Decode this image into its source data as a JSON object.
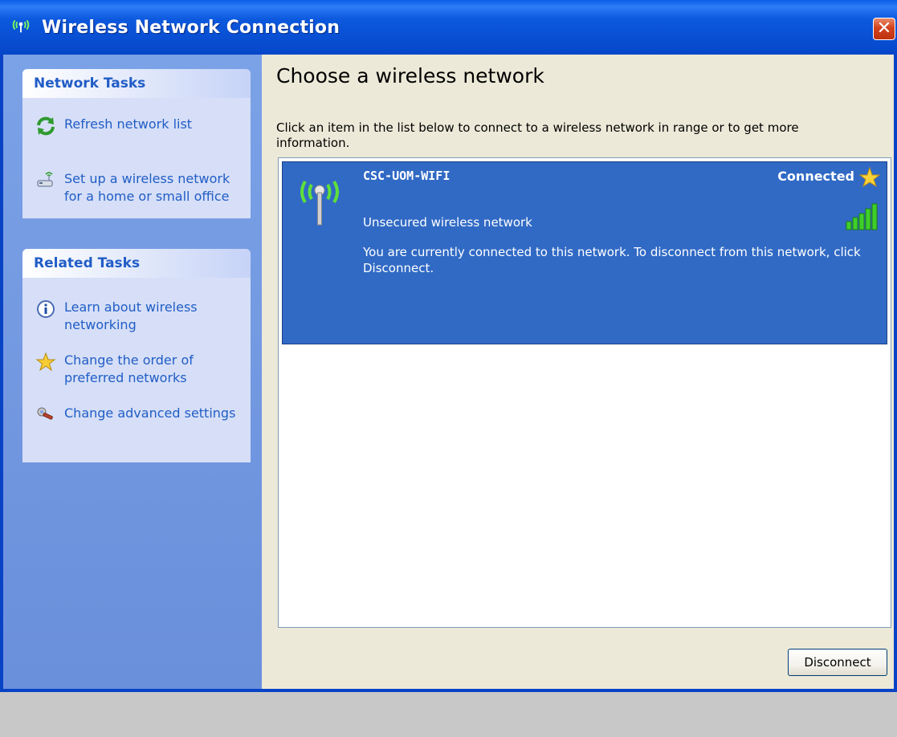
{
  "window": {
    "title": "Wireless Network Connection",
    "close_label": "✕"
  },
  "sidebar": {
    "network_tasks": {
      "header": "Network Tasks",
      "items": [
        {
          "label": "Refresh network list",
          "icon": "refresh-icon"
        },
        {
          "label": "Set up a wireless network for a home or small office",
          "icon": "wireless-setup-icon"
        }
      ]
    },
    "related_tasks": {
      "header": "Related Tasks",
      "items": [
        {
          "label": "Learn about wireless networking",
          "icon": "info-icon"
        },
        {
          "label": "Change the order of preferred networks",
          "icon": "star-icon"
        },
        {
          "label": "Change advanced settings",
          "icon": "wrench-icon"
        }
      ]
    }
  },
  "main": {
    "heading": "Choose a wireless network",
    "instruction": "Click an item in the list below to connect to a wireless network in range or to get more information.",
    "networks": [
      {
        "name": "CSC-UOM-WIFI",
        "status": "Connected",
        "security": "Unsecured wireless network",
        "description": "You are currently connected to this network. To disconnect from this network, click Disconnect.",
        "signal_bars": 5
      }
    ],
    "disconnect_label": "Disconnect"
  },
  "colors": {
    "titlebar": "#0a5ee6",
    "sidebar": "#7ba2e7",
    "task_link": "#215dc6",
    "selection": "#316ac5",
    "content_bg": "#ece9d8"
  }
}
